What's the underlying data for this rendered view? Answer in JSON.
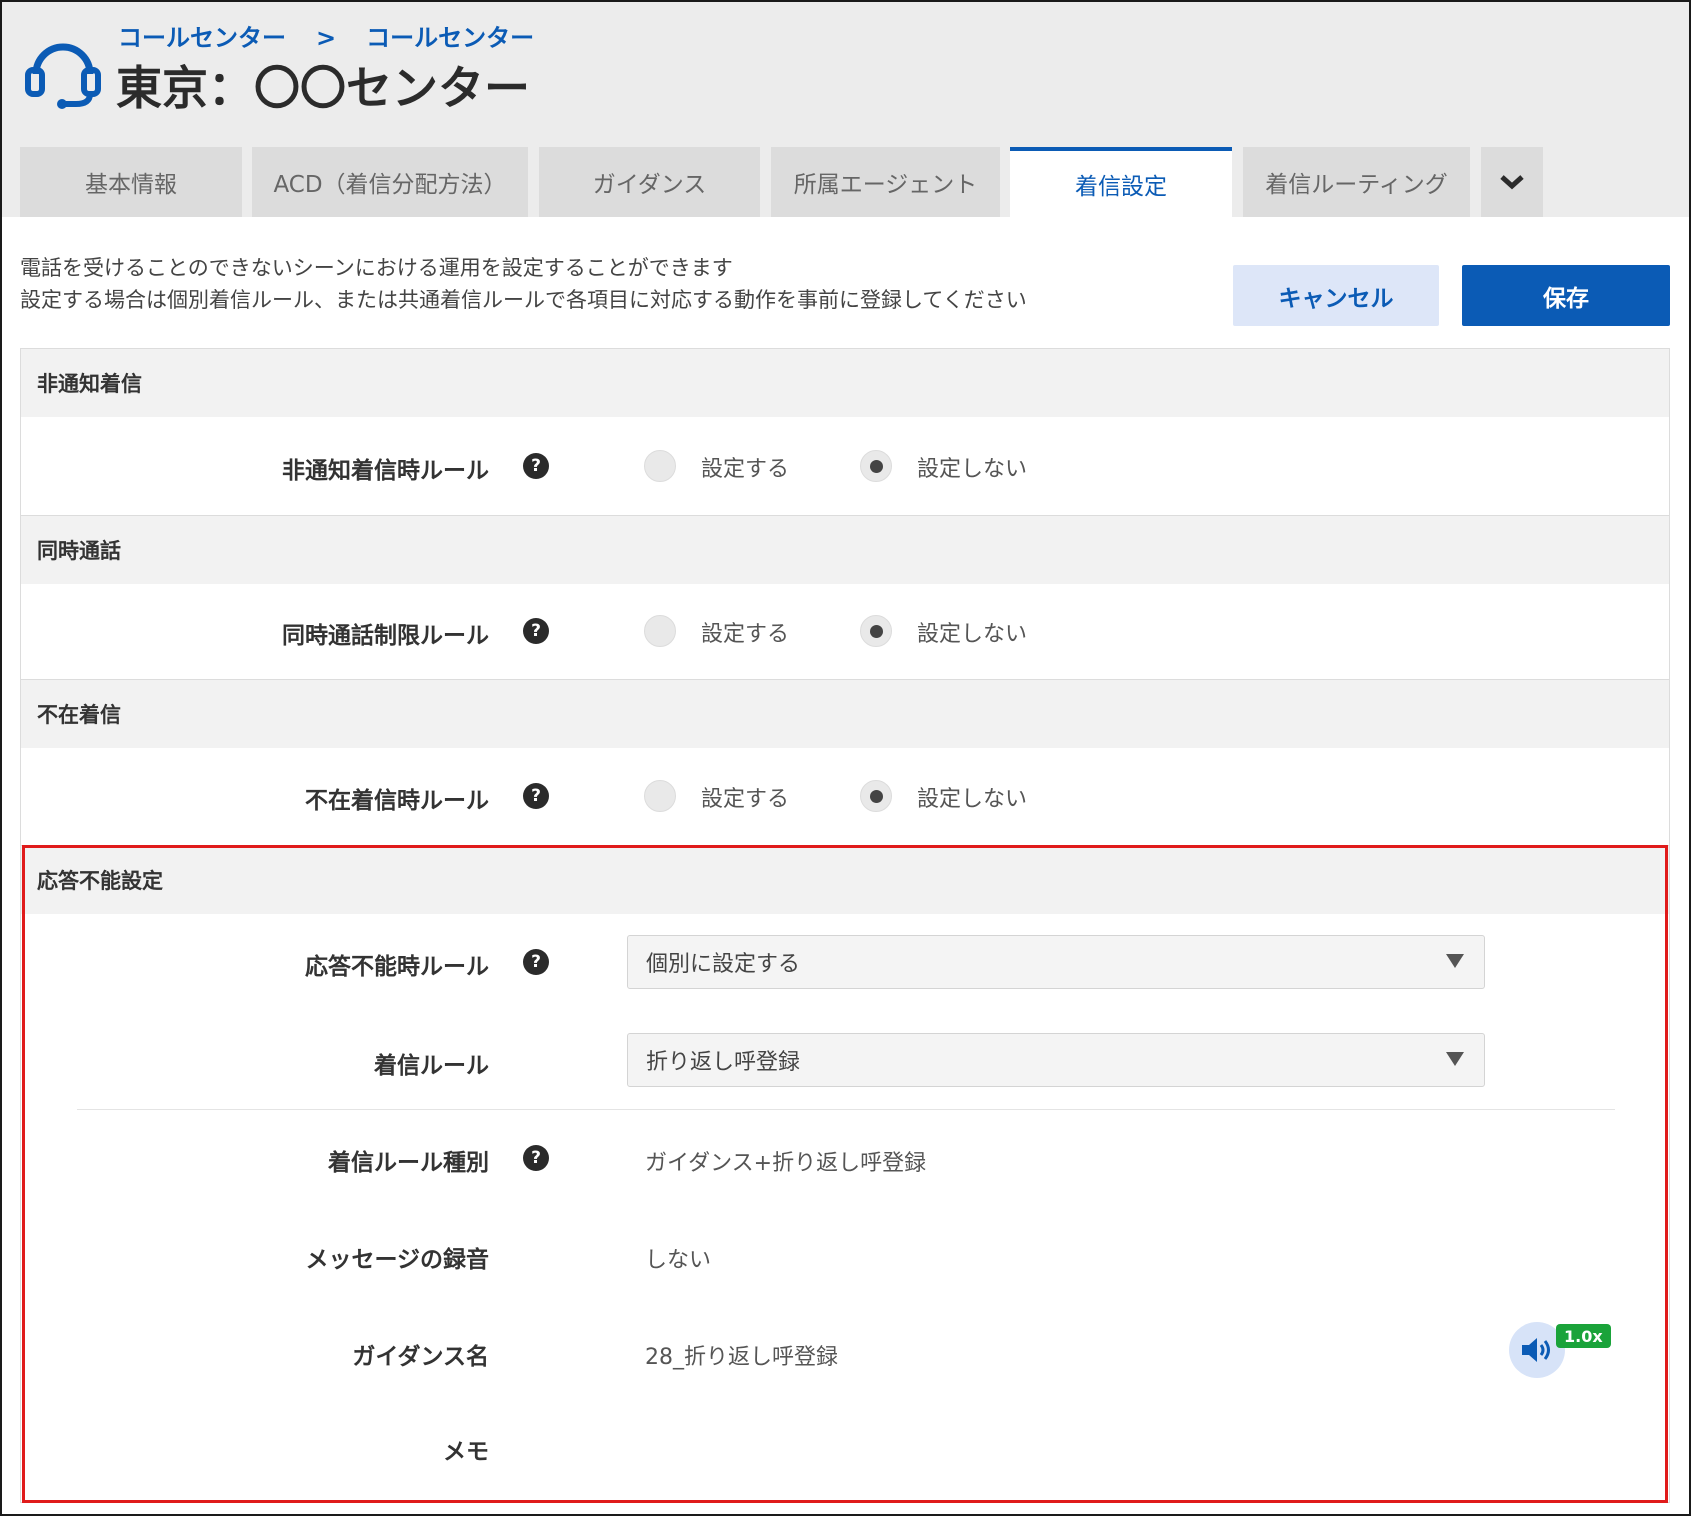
{
  "header": {
    "breadcrumb": [
      "コールセンター",
      "コールセンター"
    ],
    "breadcrumb_separator": ">",
    "title": "東京：〇〇センター",
    "logo_icon": "headset-icon"
  },
  "tabs": [
    {
      "label": "基本情報"
    },
    {
      "label": "ACD（着信分配方法）"
    },
    {
      "label": "ガイダンス"
    },
    {
      "label": "所属エージェント"
    },
    {
      "label": "着信設定",
      "active": true
    },
    {
      "label": "着信ルーティング"
    }
  ],
  "tab_more_icon": "chevron-down-icon",
  "description": {
    "line1": "電話を受けることのできないシーンにおける運用を設定することができます",
    "line2": "設定する場合は個別着信ルール、または共通着信ルールで各項目に対応する動作を事前に登録してください"
  },
  "buttons": {
    "cancel": "キャンセル",
    "save": "保存"
  },
  "sections": {
    "anonymous": {
      "title": "非通知着信",
      "rule_label": "非通知着信時ルール",
      "option_on": "設定する",
      "option_off": "設定しない",
      "selected": "設定しない"
    },
    "concurrent": {
      "title": "同時通話",
      "rule_label": "同時通話制限ルール",
      "option_on": "設定する",
      "option_off": "設定しない",
      "selected": "設定しない"
    },
    "absence": {
      "title": "不在着信",
      "rule_label": "不在着信時ルール",
      "option_on": "設定する",
      "option_off": "設定しない",
      "selected": "設定しない"
    },
    "unanswerable": {
      "title": "応答不能設定",
      "rule_label": "応答不能時ルール",
      "rule_value": "個別に設定する",
      "incoming_rule_label": "着信ルール",
      "incoming_rule_value": "折り返し呼登録",
      "rule_type_label": "着信ルール種別",
      "rule_type_value": "ガイダンス+折り返し呼登録",
      "recording_label": "メッセージの録音",
      "recording_value": "しない",
      "guidance_label": "ガイダンス名",
      "guidance_value": "28_折り返し呼登録",
      "playback_speed": "1.0x",
      "memo_label": "メモ",
      "memo_value": ""
    }
  },
  "help_glyph": "?",
  "colors": {
    "accent": "#0b5bb5",
    "highlight_border": "#e01b1b",
    "speed_badge": "#1aa33a"
  }
}
